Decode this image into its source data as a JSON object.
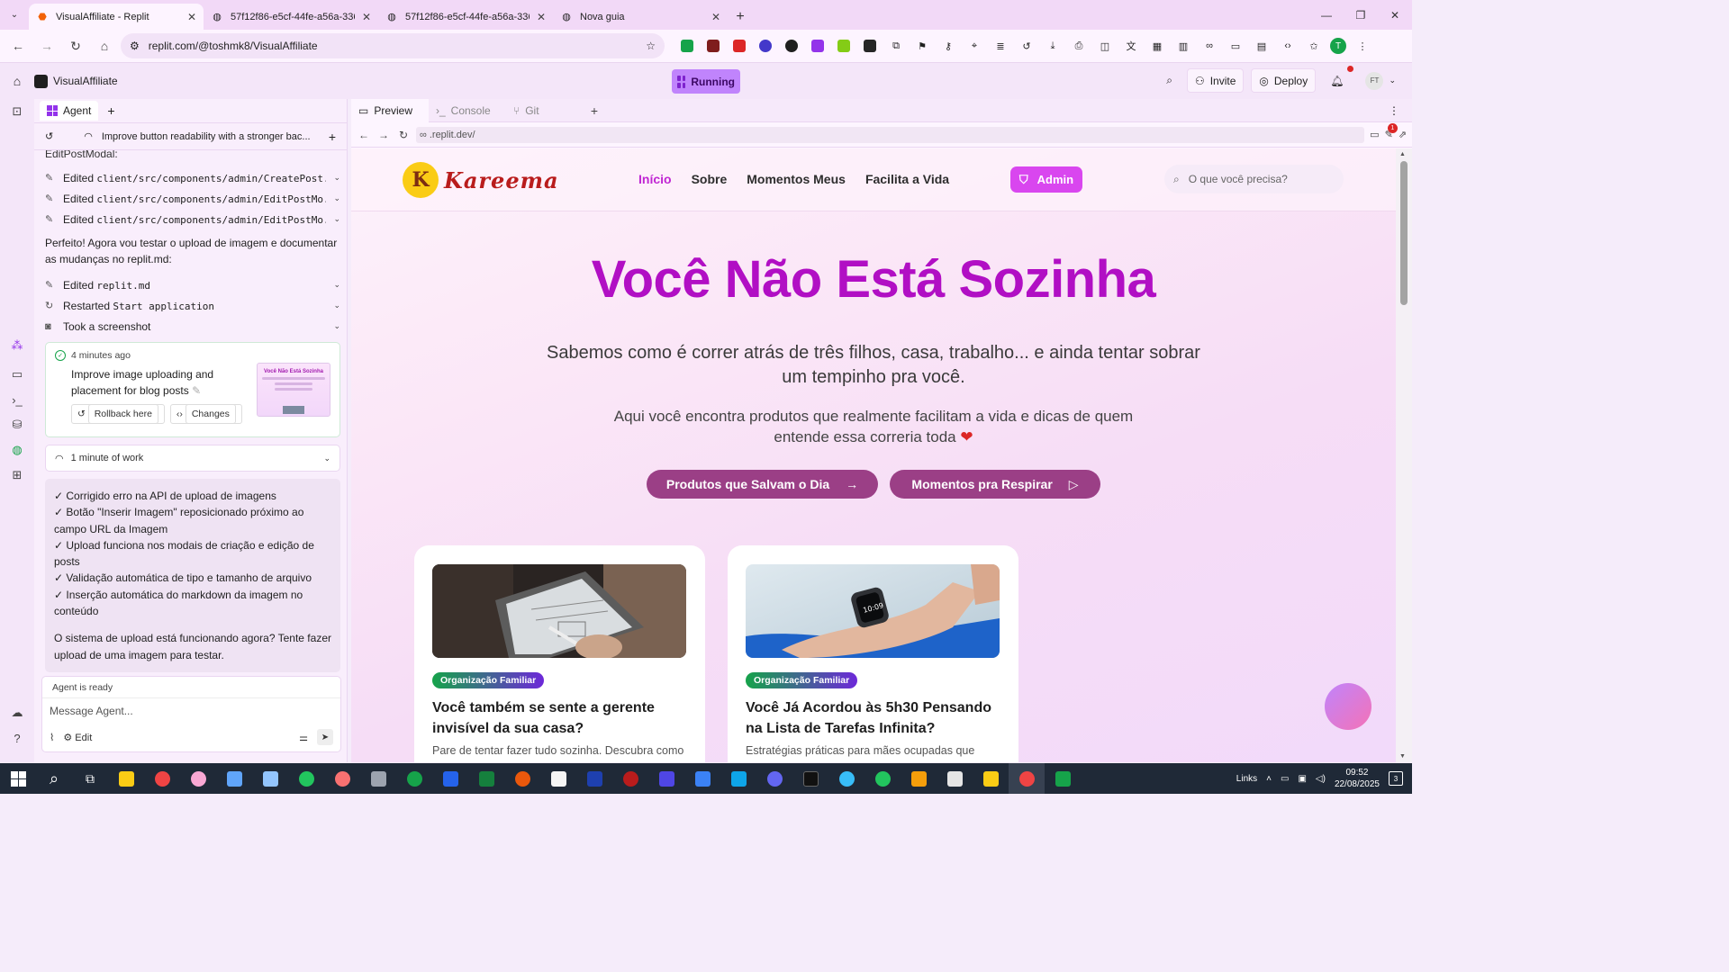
{
  "browser": {
    "tabs": [
      {
        "title": "VisualAffiliate - Replit",
        "active": true,
        "icon": "replit-icon"
      },
      {
        "title": "57f12f86-e5cf-44fe-a56a-336b",
        "active": false,
        "icon": "globe-icon"
      },
      {
        "title": "57f12f86-e5cf-44fe-a56a-336b",
        "active": false,
        "icon": "globe-icon"
      },
      {
        "title": "Nova guia",
        "active": false,
        "icon": "chrome-icon"
      }
    ],
    "url": "replit.com/@toshmk8/VisualAffiliate",
    "profile_initial": "T"
  },
  "replit": {
    "project_name": "VisualAffiliate",
    "run_status": "Running",
    "invite_label": "Invite",
    "deploy_label": "Deploy",
    "avatar_initials": "FT"
  },
  "agent": {
    "tab_label": "Agent",
    "thread_title": "Improve button readability with a stronger bac...",
    "cut_text": "EditPostModal:",
    "edits": [
      {
        "prefix": "Edited",
        "file": "client/src/components/admin/CreatePost..."
      },
      {
        "prefix": "Edited",
        "file": "client/src/components/admin/EditPostMo..."
      },
      {
        "prefix": "Edited",
        "file": "client/src/components/admin/EditPostMo..."
      }
    ],
    "message": "Perfeito! Agora vou testar o upload de imagem e documentar as mudanças no replit.md:",
    "actions": [
      {
        "prefix": "Edited",
        "code": "replit.md",
        "icon": "edit-icon"
      },
      {
        "prefix": "Restarted",
        "code": "Start application",
        "icon": "restart-icon"
      },
      {
        "prefix": "Took a screenshot",
        "code": "",
        "icon": "camera-icon"
      }
    ],
    "checkpoint": {
      "time": "4 minutes ago",
      "description": "Improve image uploading and placement for blog posts",
      "rollback_label": "Rollback here",
      "changes_label": "Changes",
      "thumb_title": "Você Não Está Sozinha"
    },
    "work_label": "1 minute of work",
    "summary_items": [
      "✓ Corrigido erro na API de upload de imagens",
      "✓ Botão \"Inserir Imagem\" reposicionado próximo ao campo URL da Imagem",
      "✓ Upload funciona nos modais de criação e edição de posts",
      "✓ Validação automática de tipo e tamanho de arquivo",
      "✓ Inserção automática do markdown da imagem no conteúdo"
    ],
    "summary_question": "O sistema de upload está funcionando agora? Tente fazer upload de uma imagem para testar.",
    "status": "Agent is ready",
    "input_placeholder": "Message Agent...",
    "edit_label": "Edit"
  },
  "preview": {
    "tabs": [
      "Preview",
      "Console",
      "Git"
    ],
    "url": ".replit.dev/",
    "badge_count": "1"
  },
  "site": {
    "brand": "Kareema",
    "menu": [
      "Início",
      "Sobre",
      "Momentos Meus",
      "Facilita a Vida"
    ],
    "admin_label": "Admin",
    "search_placeholder": "O que você precisa?",
    "hero_title": "Você Não Está Sozinha",
    "hero_sub": "Sabemos como é correr atrás de três filhos, casa, trabalho... e ainda tentar sobrar um tempinho pra você.",
    "hero_sub2": "Aqui você encontra produtos que realmente facilitam a vida e dicas de quem entende essa correria toda",
    "cta_primary": "Produtos que Salvam o Dia",
    "cta_secondary": "Momentos pra Respirar",
    "cards": [
      {
        "tag": "Organização Familiar",
        "title": "Você também se sente a gerente invisível da sua casa?",
        "desc": "Pare de tentar fazer tudo sozinha. Descubra como"
      },
      {
        "tag": "Organização Familiar",
        "title": "Você Já Acordou às 5h30 Pensando na Lista de Tarefas Infinita?",
        "desc": "Estratégias práticas para mães ocupadas que"
      }
    ]
  },
  "taskbar": {
    "links_label": "Links",
    "time": "09:52",
    "date": "22/08/2025",
    "notif_count": "3"
  }
}
